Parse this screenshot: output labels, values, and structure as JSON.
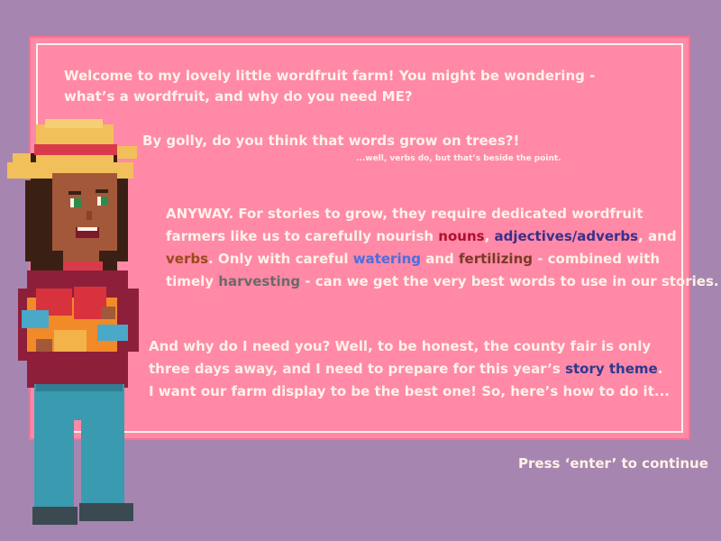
{
  "dialog": {
    "p1_line1": "Welcome to my lovely little wordfruit farm! You might be wondering -",
    "p1_line2": "what’s a wordfruit, and why do you need ME?",
    "p2_line1": "By golly, do you think that words grow on trees?!",
    "p2_aside": "...well, verbs do, but that’s beside the point.",
    "p3_l1": "ANYWAY. For stories to grow, they require dedicated wordfruit",
    "p3_l2_a": "farmers like us to carefully nourish ",
    "p3_l2_nouns": "nouns",
    "p3_l2_b": ", ",
    "p3_l2_adj": "adjectives/adverbs",
    "p3_l2_c": ", and",
    "p3_l3_verbs": "verbs",
    "p3_l3_a": ". Only with careful ",
    "p3_l3_water": "watering",
    "p3_l3_b": " and ",
    "p3_l3_fert": "fertilizing",
    "p3_l3_c": " - combined with",
    "p3_l4_a": "timely ",
    "p3_l4_harv": "harvesting",
    "p3_l4_b": " - can we get the very best words to use in our stories.",
    "p4_l1": "And why do I need you? Well, to be honest, the county fair is only",
    "p4_l2_a": "three days away, and I need to prepare for this year’s ",
    "p4_l2_theme": "story theme",
    "p4_l2_b": ".",
    "p4_l3": "I want our farm display to be the best one! So, here’s how to do it..."
  },
  "prompt": {
    "continue": "Press ‘enter’ to continue"
  },
  "colors": {
    "background": "#a686b0",
    "panel": "#ff89a6",
    "text": "#fff2e8",
    "nouns": "#b0102c",
    "adjectives": "#3b2f8a",
    "verbs": "#9a4a1a",
    "watering": "#4a6ee0",
    "fertilizing": "#7a3a24",
    "harvesting": "#6a6a6a",
    "story_theme": "#2a3a90"
  },
  "character": {
    "icon": "farmer-girl-icon"
  }
}
